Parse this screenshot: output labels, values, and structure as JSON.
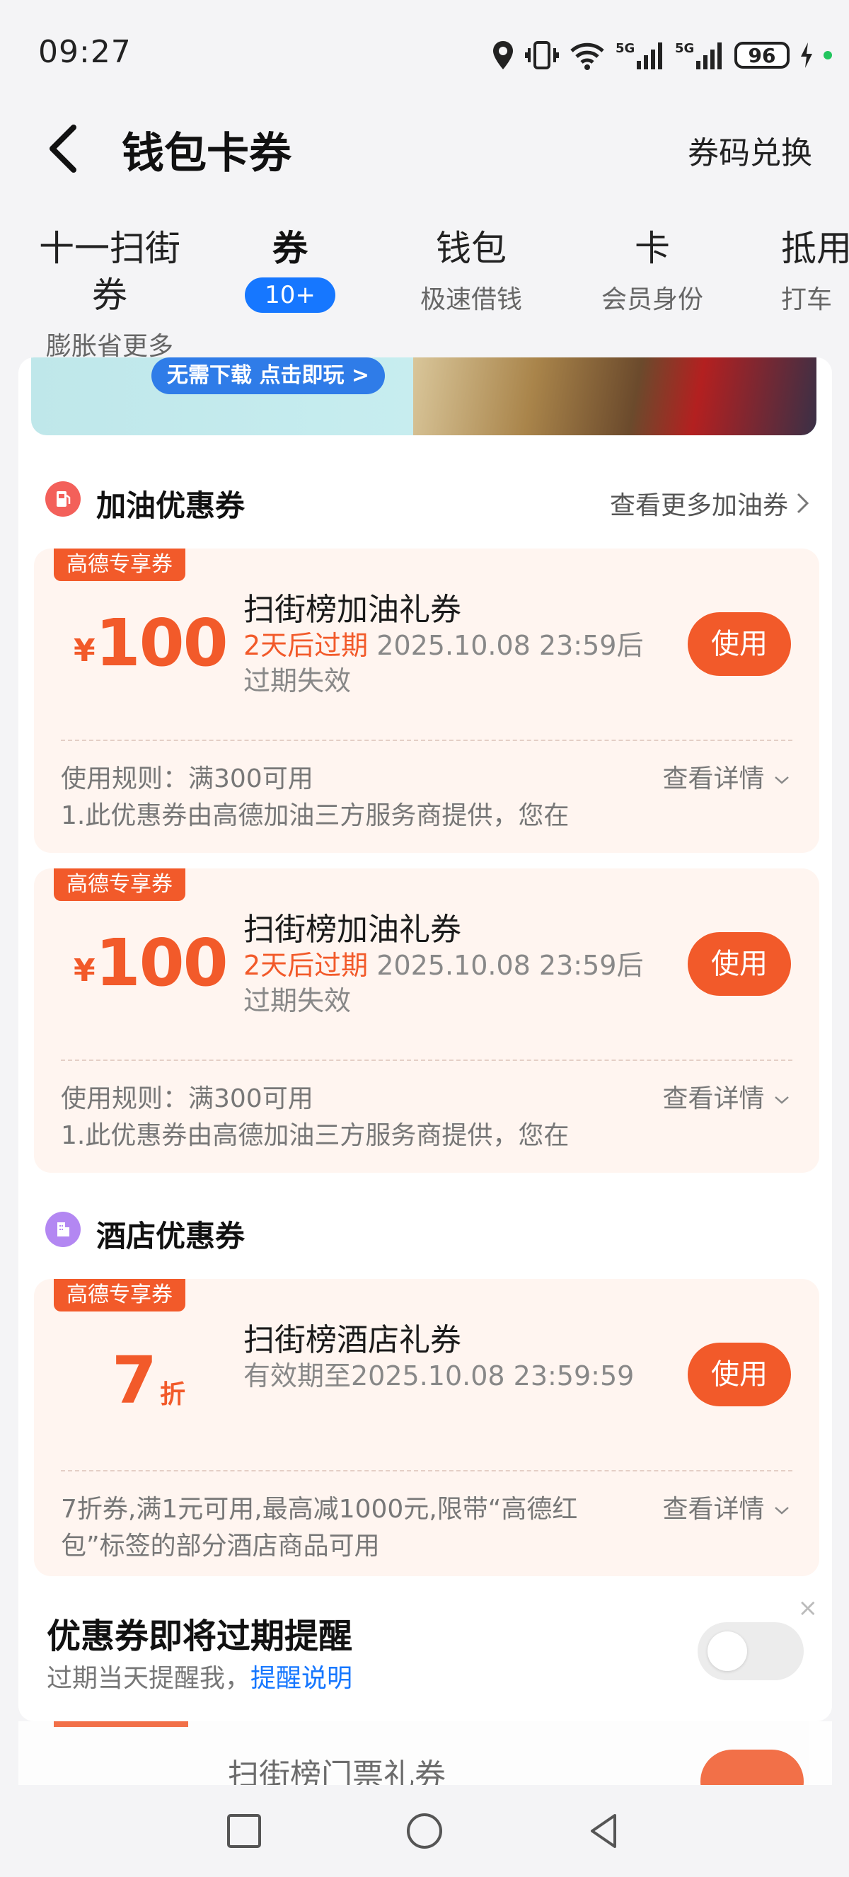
{
  "status": {
    "time": "09:27",
    "battery": "96",
    "network": "5G"
  },
  "header": {
    "title": "钱包卡券",
    "redeem": "券码兑换"
  },
  "tabs": [
    {
      "main": "十一扫街券",
      "sub": "膨胀省更多"
    },
    {
      "main": "券",
      "badge": "10+"
    },
    {
      "main": "钱包",
      "sub": "极速借钱"
    },
    {
      "main": "卡",
      "sub": "会员身份"
    },
    {
      "main": "抵用",
      "sub": "打车"
    }
  ],
  "banner": {
    "pill": "无需下载 点击即玩 >"
  },
  "fuel": {
    "title": "加油优惠券",
    "more": "查看更多加油券",
    "coupons": [
      {
        "tag": "高德专享券",
        "currency": "¥",
        "amount": "100",
        "name": "扫街榜加油礼券",
        "warn": "2天后过期",
        "expire": "2025.10.08 23:59后过期失效",
        "use": "使用",
        "rule": "使用规则：满300可用",
        "rule2": "1.此优惠券由高德加油三方服务商提供，您在",
        "detail": "查看详情"
      },
      {
        "tag": "高德专享券",
        "currency": "¥",
        "amount": "100",
        "name": "扫街榜加油礼券",
        "warn": "2天后过期",
        "expire": "2025.10.08 23:59后过期失效",
        "use": "使用",
        "rule": "使用规则：满300可用",
        "rule2": "1.此优惠券由高德加油三方服务商提供，您在",
        "detail": "查看详情"
      }
    ]
  },
  "hotel": {
    "title": "酒店优惠券",
    "coupon": {
      "tag": "高德专享券",
      "value": "7",
      "unit": "折",
      "name": "扫街榜酒店礼券",
      "expire": "有效期至2025.10.08 23:59:59",
      "use": "使用",
      "rule": "7折券,满1元可用,最高减1000元,限带“高德红包”标签的部分酒店商品可用",
      "detail": "查看详情"
    }
  },
  "reminder": {
    "title": "优惠券即将过期提醒",
    "sub": "过期当天提醒我，",
    "link": "提醒说明",
    "close": "×"
  },
  "peek": {
    "name": "扫街榜门票礼券"
  },
  "colors": {
    "accent": "#f25a2a",
    "blue": "#1677ff"
  }
}
